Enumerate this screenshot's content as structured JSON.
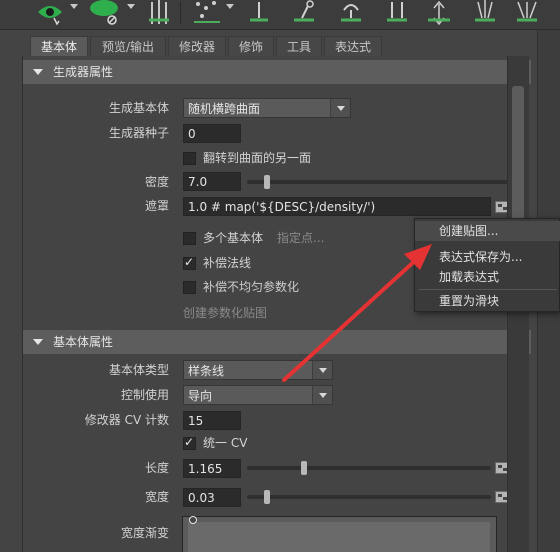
{
  "shelf": {
    "icons": [
      "eye-icon",
      "sphere-off-icon",
      "grass-spline-icon",
      "scatter-icon",
      "lamp-icon",
      "lamp-tilt-icon",
      "lamp-dome-icon",
      "pillar-icon",
      "grass-tuft-icon",
      "scale-arrow-icon",
      "brush-grass-icon",
      "fan-grass-icon"
    ]
  },
  "tabs": [
    "基本体",
    "预览/输出",
    "修改器",
    "修饰",
    "工具",
    "表达式"
  ],
  "active_tab": 0,
  "section_generator": {
    "title": "生成器属性",
    "primitive_label": "生成基本体",
    "primitive_value": "随机横跨曲面",
    "seed_label": "生成器种子",
    "seed_value": "0",
    "flip_label": "翻转到曲面的另一面",
    "density_label": "密度",
    "density_value": "7.0",
    "density_level": 0.06,
    "mask_label": "遮罩",
    "mask_value": "1.0 # map('${DESC}/density/')",
    "multi_primitive_label": "多个基本体",
    "assign_label": "指定点...",
    "compensate_normals_label": "补偿法线",
    "compensate_normals_checked": true,
    "compensate_uneven_label": "补偿不均匀参数化",
    "create_param_map_label": "创建参数化贴图"
  },
  "section_primitive": {
    "title": "基本体属性",
    "type_label": "基本体类型",
    "type_value": "样条线",
    "control_label": "控制使用",
    "control_value": "导向",
    "cv_count_label": "修改器 CV 计数",
    "cv_count_value": "15",
    "uniform_cv_label": "统一 CV",
    "uniform_cv_checked": true,
    "length_label": "长度",
    "length_value": "1.165",
    "length_level": 0.22,
    "width_label": "宽度",
    "width_value": "0.03",
    "width_level": 0.07,
    "width_ramp_label": "宽度渐变"
  },
  "context_menu": {
    "items": [
      "创建贴图...",
      "表达式保存为...",
      "加载表达式",
      "重置为滑块"
    ]
  },
  "colors": {
    "panel_bg": "#444444",
    "field_bg": "#2b2b2b",
    "annotation_arrow": "#e53333"
  }
}
